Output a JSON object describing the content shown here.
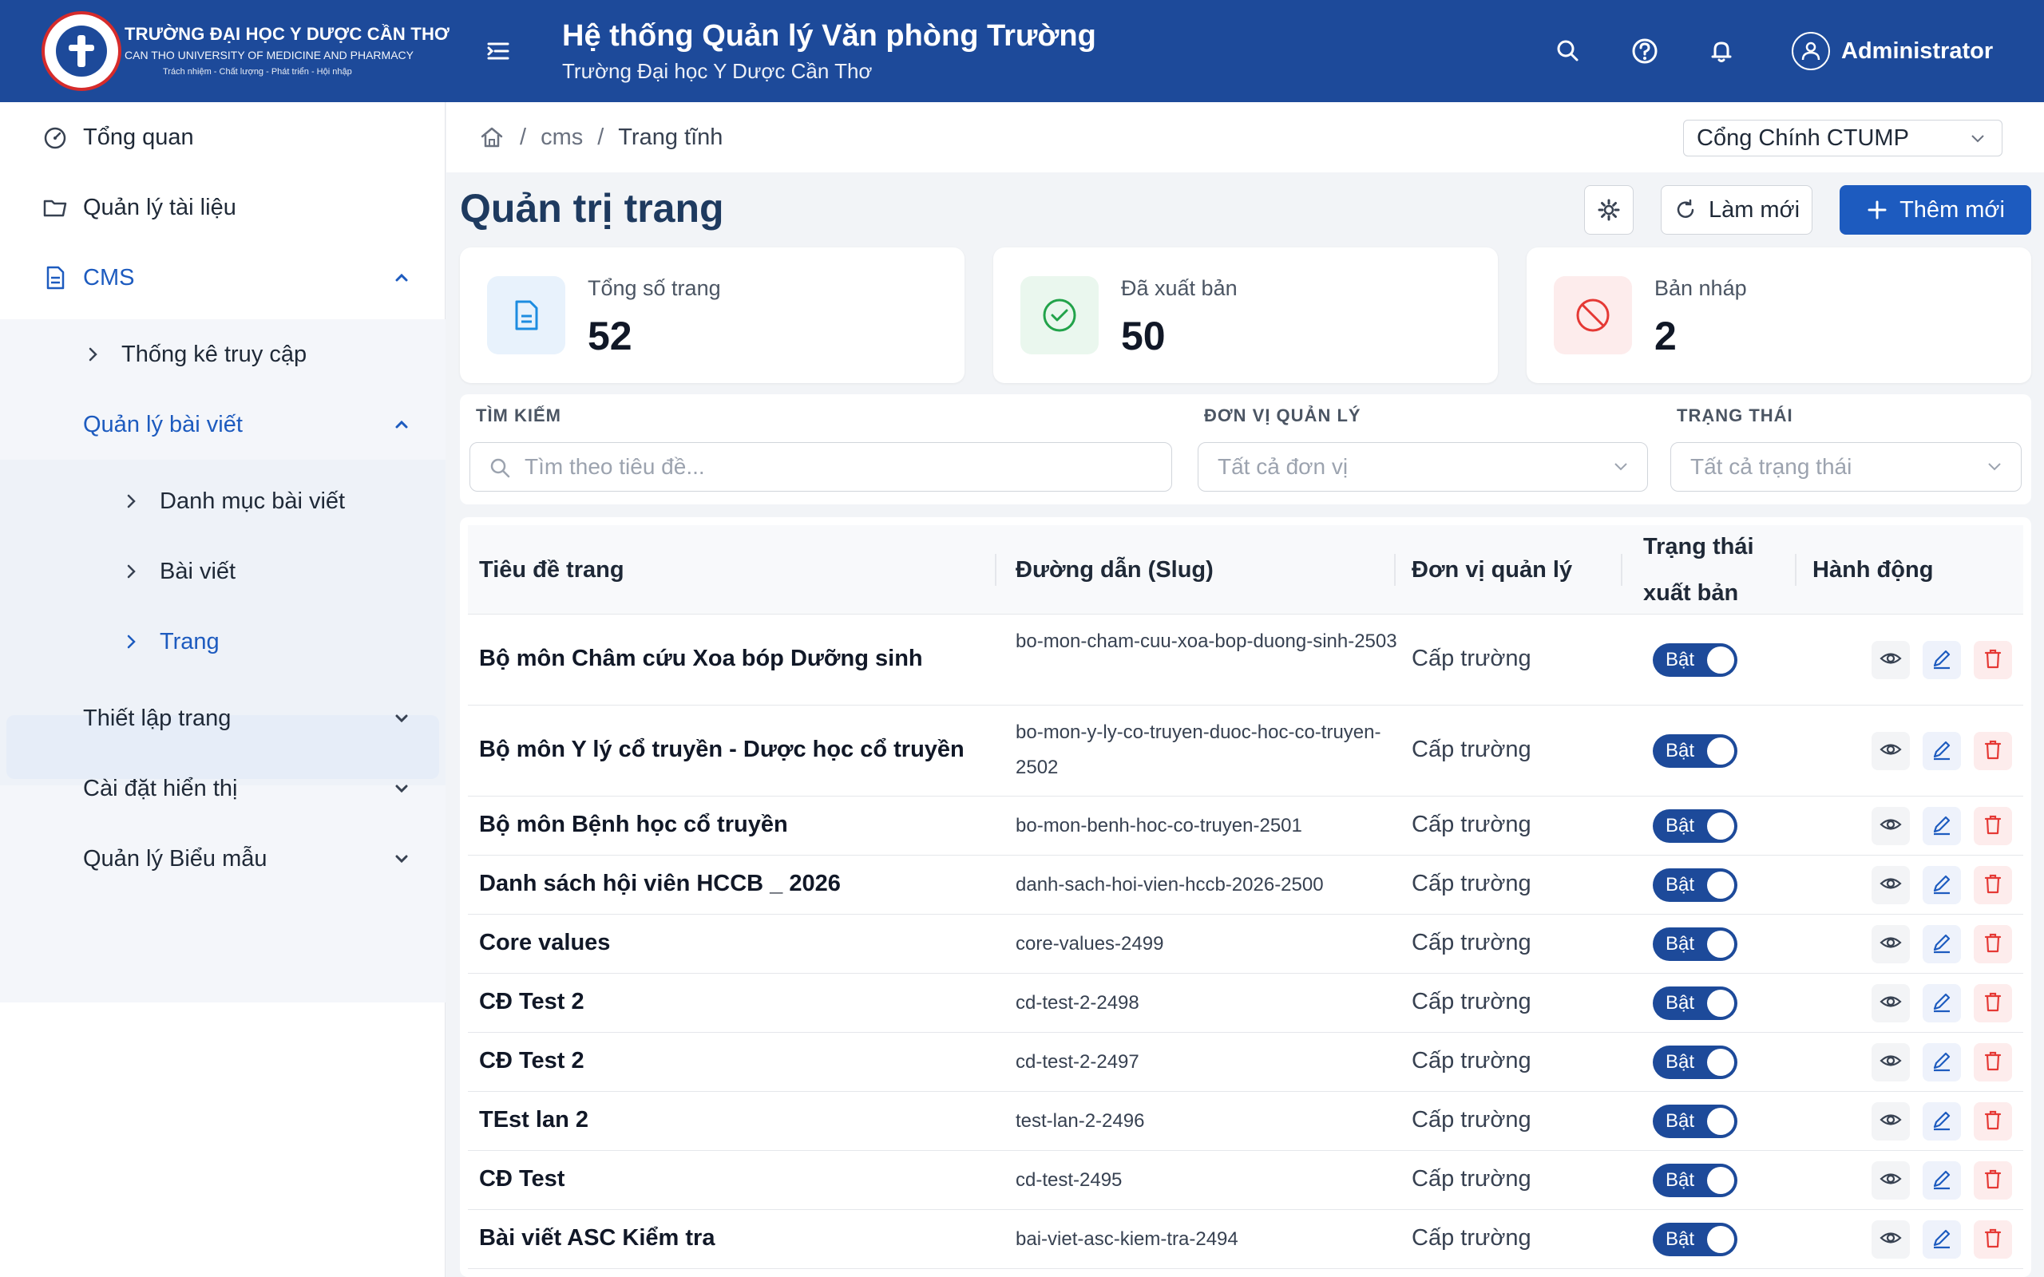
{
  "header": {
    "university_name": "TRƯỜNG ĐẠI HỌC Y DƯỢC CẦN THƠ",
    "university_english": "CAN THO UNIVERSITY OF MEDICINE AND PHARMACY",
    "motto": "Trách nhiệm - Chất lượng - Phát triển - Hội nhập",
    "system_title": "Hệ thống Quản lý Văn phòng Trường",
    "system_subtitle": "Trường Đại học Y Dược Cần Thơ",
    "user_name": "Administrator",
    "icons": [
      "menu-icon",
      "search-icon",
      "help-icon",
      "bell-icon",
      "user-icon"
    ]
  },
  "sidebar": {
    "items": [
      {
        "label": "Tổng quan",
        "icon": "dashboard-icon"
      },
      {
        "label": "Quản lý tài liệu",
        "icon": "folder-icon"
      },
      {
        "label": "CMS",
        "icon": "document-icon",
        "expanded": true
      },
      {
        "label": "Thống kê truy cập"
      },
      {
        "label": "Quản lý bài viết",
        "expanded": true
      },
      {
        "label": "Danh mục bài viết"
      },
      {
        "label": "Bài viết"
      },
      {
        "label": "Trang",
        "selected": true
      },
      {
        "label": "Thiết lập trang"
      },
      {
        "label": "Cài đặt hiển thị"
      },
      {
        "label": "Quản lý Biểu mẫu"
      }
    ]
  },
  "breadcrumb": {
    "sep": "/",
    "items": [
      "cms",
      "Trang tĩnh"
    ]
  },
  "portal_select": {
    "value": "Cổng Chính CTUMP"
  },
  "page": {
    "title": "Quản trị trang",
    "refresh_label": "Làm mới",
    "add_label": "Thêm mới"
  },
  "stats": [
    {
      "label": "Tổng số trang",
      "value": "52",
      "color": "#1d8ce0"
    },
    {
      "label": "Đã xuất bản",
      "value": "50",
      "color": "#22a34a"
    },
    {
      "label": "Bản nháp",
      "value": "2",
      "color": "#e53935"
    }
  ],
  "filters": {
    "search_label": "TÌM KIẾM",
    "search_placeholder": "Tìm theo tiêu đề...",
    "unit_label": "ĐƠN VỊ QUẢN LÝ",
    "unit_value": "Tất cả đơn vị",
    "status_label": "TRẠNG THÁI",
    "status_value": "Tất cả trạng thái"
  },
  "table": {
    "headers": [
      "Tiêu đề trang",
      "Đường dẫn (Slug)",
      "Đơn vị quản lý",
      "Trạng thái xuất bản",
      "Hành động"
    ],
    "toggle_label": "Bật",
    "rows": [
      {
        "title": "Bộ môn Châm cứu Xoa bóp Dưỡng sinh",
        "slug": "bo-mon-cham-cuu-xoa-bop-duong-sinh-2503",
        "unit": "Cấp trường"
      },
      {
        "title": "Bộ môn Y lý cổ truyền - Dược học cổ truyền",
        "slug": "bo-mon-y-ly-co-truyen-duoc-hoc-co-truyen-2502",
        "unit": "Cấp trường"
      },
      {
        "title": "Bộ môn Bệnh học cổ truyền",
        "slug": "bo-mon-benh-hoc-co-truyen-2501",
        "unit": "Cấp trường"
      },
      {
        "title": "Danh sách hội viên HCCB _ 2026",
        "slug": "danh-sach-hoi-vien-hccb-2026-2500",
        "unit": "Cấp trường"
      },
      {
        "title": "Core values",
        "slug": "core-values-2499",
        "unit": "Cấp trường"
      },
      {
        "title": "CĐ Test 2",
        "slug": "cd-test-2-2498",
        "unit": "Cấp trường"
      },
      {
        "title": "CĐ Test 2",
        "slug": "cd-test-2-2497",
        "unit": "Cấp trường"
      },
      {
        "title": "TEst lan 2",
        "slug": "test-lan-2-2496",
        "unit": "Cấp trường"
      },
      {
        "title": "CĐ Test",
        "slug": "cd-test-2495",
        "unit": "Cấp trường"
      },
      {
        "title": "Bài viết ASC Kiểm tra",
        "slug": "bai-viet-asc-kiem-tra-2494",
        "unit": "Cấp trường"
      }
    ]
  }
}
